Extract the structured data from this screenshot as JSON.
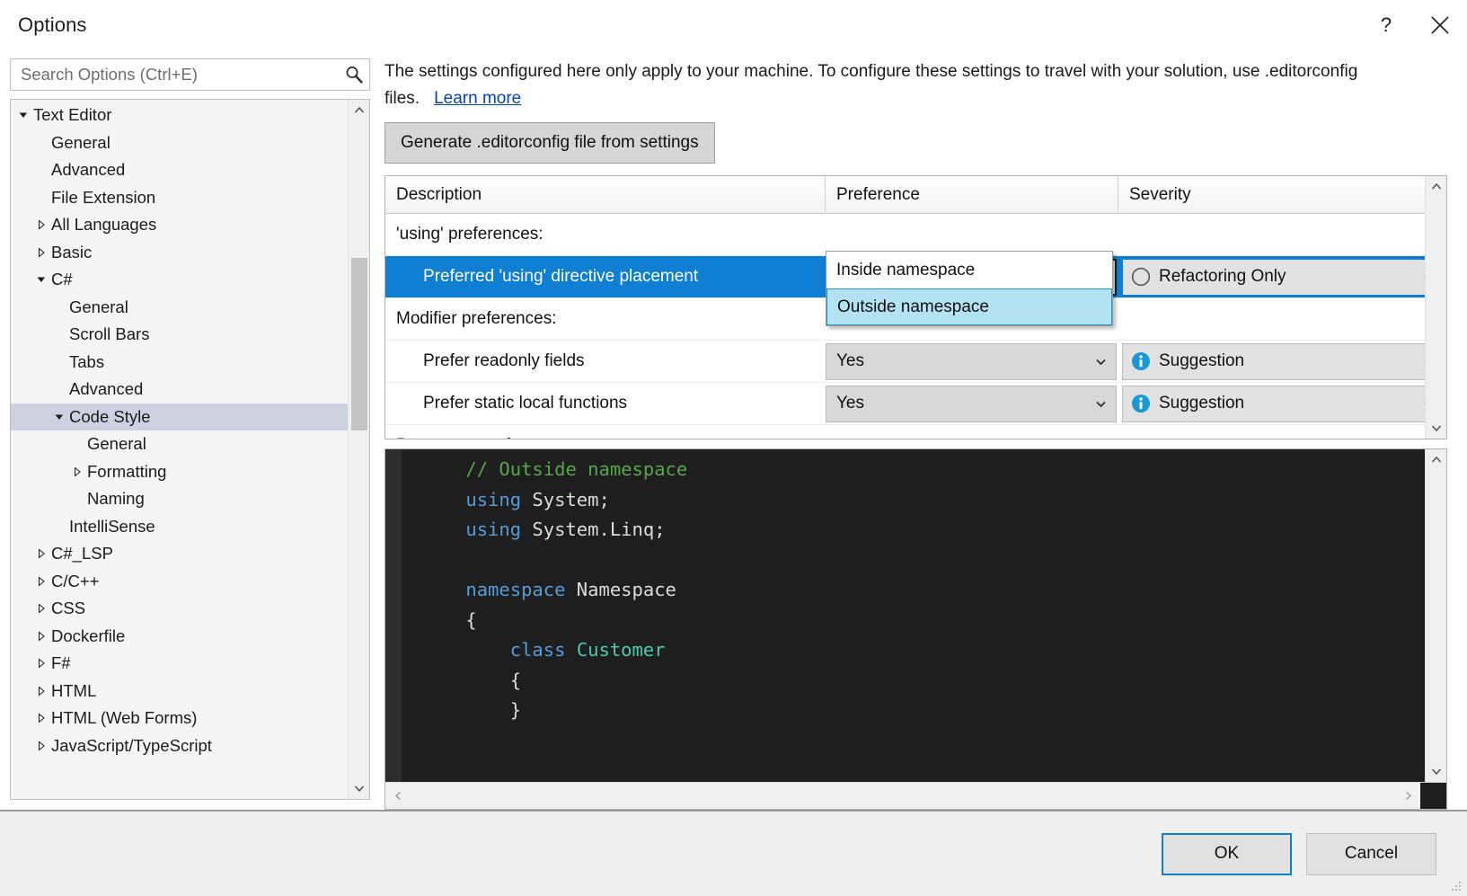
{
  "window": {
    "title": "Options",
    "help_icon": "question-mark-icon",
    "close_icon": "close-icon"
  },
  "search": {
    "placeholder": "Search Options (Ctrl+E)",
    "value": "",
    "icon": "search-icon"
  },
  "tree": {
    "items": [
      {
        "label": "Text Editor",
        "indent": 0,
        "twisty": "expanded",
        "selected": false
      },
      {
        "label": "General",
        "indent": 1,
        "twisty": "none",
        "selected": false
      },
      {
        "label": "Advanced",
        "indent": 1,
        "twisty": "none",
        "selected": false
      },
      {
        "label": "File Extension",
        "indent": 1,
        "twisty": "none",
        "selected": false
      },
      {
        "label": "All Languages",
        "indent": 1,
        "twisty": "collapsed",
        "selected": false
      },
      {
        "label": "Basic",
        "indent": 1,
        "twisty": "collapsed",
        "selected": false
      },
      {
        "label": "C#",
        "indent": 1,
        "twisty": "expanded",
        "selected": false
      },
      {
        "label": "General",
        "indent": 2,
        "twisty": "none",
        "selected": false
      },
      {
        "label": "Scroll Bars",
        "indent": 2,
        "twisty": "none",
        "selected": false
      },
      {
        "label": "Tabs",
        "indent": 2,
        "twisty": "none",
        "selected": false
      },
      {
        "label": "Advanced",
        "indent": 2,
        "twisty": "none",
        "selected": false
      },
      {
        "label": "Code Style",
        "indent": 2,
        "twisty": "expanded",
        "selected": true
      },
      {
        "label": "General",
        "indent": 3,
        "twisty": "none",
        "selected": false
      },
      {
        "label": "Formatting",
        "indent": 3,
        "twisty": "collapsed",
        "selected": false
      },
      {
        "label": "Naming",
        "indent": 3,
        "twisty": "none",
        "selected": false
      },
      {
        "label": "IntelliSense",
        "indent": 2,
        "twisty": "none",
        "selected": false
      },
      {
        "label": "C#_LSP",
        "indent": 1,
        "twisty": "collapsed",
        "selected": false
      },
      {
        "label": "C/C++",
        "indent": 1,
        "twisty": "collapsed",
        "selected": false
      },
      {
        "label": "CSS",
        "indent": 1,
        "twisty": "collapsed",
        "selected": false
      },
      {
        "label": "Dockerfile",
        "indent": 1,
        "twisty": "collapsed",
        "selected": false
      },
      {
        "label": "F#",
        "indent": 1,
        "twisty": "collapsed",
        "selected": false
      },
      {
        "label": "HTML",
        "indent": 1,
        "twisty": "collapsed",
        "selected": false
      },
      {
        "label": "HTML (Web Forms)",
        "indent": 1,
        "twisty": "collapsed",
        "selected": false
      },
      {
        "label": "JavaScript/TypeScript",
        "indent": 1,
        "twisty": "collapsed",
        "selected": false
      }
    ]
  },
  "info": {
    "text": "The settings configured here only apply to your machine. To configure these settings to travel with your solution, use .editorconfig files.",
    "link": "Learn more"
  },
  "generate_button": {
    "label": "Generate .editorconfig file from settings"
  },
  "grid": {
    "columns": [
      "Description",
      "Preference",
      "Severity"
    ],
    "rows": [
      {
        "kind": "group",
        "description": "'using' preferences:",
        "preference": null,
        "severity": null,
        "selected": false
      },
      {
        "kind": "setting",
        "description": "Preferred 'using' directive placement",
        "preference": "Outside namespace",
        "severity": "Refactoring Only",
        "severity_icon": "empty-circle-icon",
        "selected": true
      },
      {
        "kind": "group",
        "description": "Modifier preferences:",
        "preference": null,
        "severity": null,
        "selected": false
      },
      {
        "kind": "setting",
        "description": "Prefer readonly fields",
        "preference": "Yes",
        "severity": "Suggestion",
        "severity_icon": "info-icon",
        "selected": false
      },
      {
        "kind": "setting",
        "description": "Prefer static local functions",
        "preference": "Yes",
        "severity": "Suggestion",
        "severity_icon": "info-icon",
        "selected": false
      },
      {
        "kind": "group",
        "description": "Parameter preferences:",
        "preference": null,
        "severity": null,
        "selected": false
      }
    ],
    "open_dropdown": {
      "for_row": "Preferred 'using' directive placement",
      "options": [
        "Inside namespace",
        "Outside namespace"
      ],
      "highlighted": "Outside namespace"
    }
  },
  "preview": {
    "lines": [
      [
        {
          "t": "    ",
          "c": "p"
        },
        {
          "t": "// Outside namespace",
          "c": "c"
        }
      ],
      [
        {
          "t": "    ",
          "c": "p"
        },
        {
          "t": "using",
          "c": "k"
        },
        {
          "t": " System;",
          "c": "p"
        }
      ],
      [
        {
          "t": "    ",
          "c": "p"
        },
        {
          "t": "using",
          "c": "k"
        },
        {
          "t": " System.Linq;",
          "c": "p"
        }
      ],
      [
        {
          "t": "",
          "c": "p"
        }
      ],
      [
        {
          "t": "    ",
          "c": "p"
        },
        {
          "t": "namespace",
          "c": "k"
        },
        {
          "t": " Namespace",
          "c": "p"
        }
      ],
      [
        {
          "t": "    {",
          "c": "p"
        }
      ],
      [
        {
          "t": "        ",
          "c": "p"
        },
        {
          "t": "class",
          "c": "k"
        },
        {
          "t": " ",
          "c": "p"
        },
        {
          "t": "Customer",
          "c": "t"
        }
      ],
      [
        {
          "t": "        {",
          "c": "p"
        }
      ],
      [
        {
          "t": "        }",
          "c": "p"
        }
      ]
    ]
  },
  "footer": {
    "ok": "OK",
    "cancel": "Cancel"
  },
  "colors": {
    "accent": "#0f7fd4",
    "selection": "#0f7fd4",
    "tree_selection": "#cdd2e0",
    "dropdown_highlight": "#b3e2f2",
    "link": "#0645ad",
    "code_bg": "#1e1e1e",
    "comment": "#57a64a",
    "keyword": "#569cd6",
    "type": "#4ec9b0"
  }
}
